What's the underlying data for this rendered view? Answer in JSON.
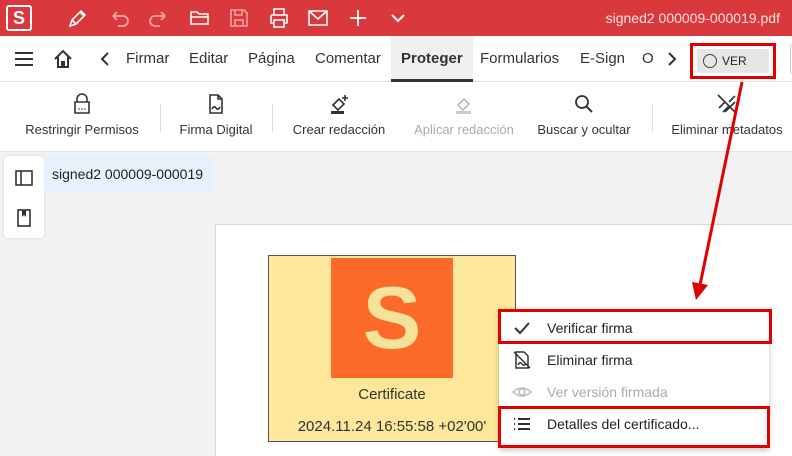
{
  "titlebar": {
    "logo": "S",
    "document_title": "signed2 000009-000019.pdf",
    "icons": [
      "pen-icon",
      "undo-icon",
      "redo-icon",
      "open-folder-icon",
      "save-icon",
      "print-icon",
      "mail-icon",
      "plus-icon",
      "chevron-down-icon"
    ],
    "color": "#d9393c"
  },
  "menubar": {
    "tabs": [
      "Firmar",
      "Editar",
      "Página",
      "Comentar",
      "Proteger",
      "Formularios",
      "E-Sign",
      "O"
    ],
    "active_tab": "Proteger",
    "ver_button": "VER"
  },
  "toolbar": {
    "tools": [
      {
        "label": "Restringir Permisos",
        "icon": "lock-icon",
        "enabled": true
      },
      {
        "label": "Firma Digital",
        "icon": "digital-signature-icon",
        "enabled": true
      },
      {
        "label": "Crear redacción",
        "icon": "create-redaction-icon",
        "enabled": true
      },
      {
        "label": "Aplicar redacción",
        "icon": "apply-redaction-icon",
        "enabled": false
      },
      {
        "label": "Buscar y ocultar",
        "icon": "search-icon",
        "enabled": true
      },
      {
        "label": "Eliminar metadatos",
        "icon": "remove-metadata-icon",
        "enabled": true
      }
    ]
  },
  "workspace": {
    "document_tab": "signed2 000009-000019",
    "side_icons": [
      "panel-icon",
      "bookmark-icon"
    ]
  },
  "certificate": {
    "logo_letter": "S",
    "name": "Certificate",
    "date": "2024.11.24 16:55:58 +02'00'",
    "bg_color": "#fce79a",
    "logo_color": "#fb6a28"
  },
  "context_menu": {
    "items": [
      {
        "label": "Verificar firma",
        "icon": "check-icon",
        "enabled": true
      },
      {
        "label": "Eliminar firma",
        "icon": "remove-signature-icon",
        "enabled": true
      },
      {
        "label": "Ver versión firmada",
        "icon": "eye-icon",
        "enabled": false
      },
      {
        "label": "Detalles del certificado...",
        "icon": "list-icon",
        "enabled": true
      }
    ]
  },
  "annotation_color": "#e00000"
}
